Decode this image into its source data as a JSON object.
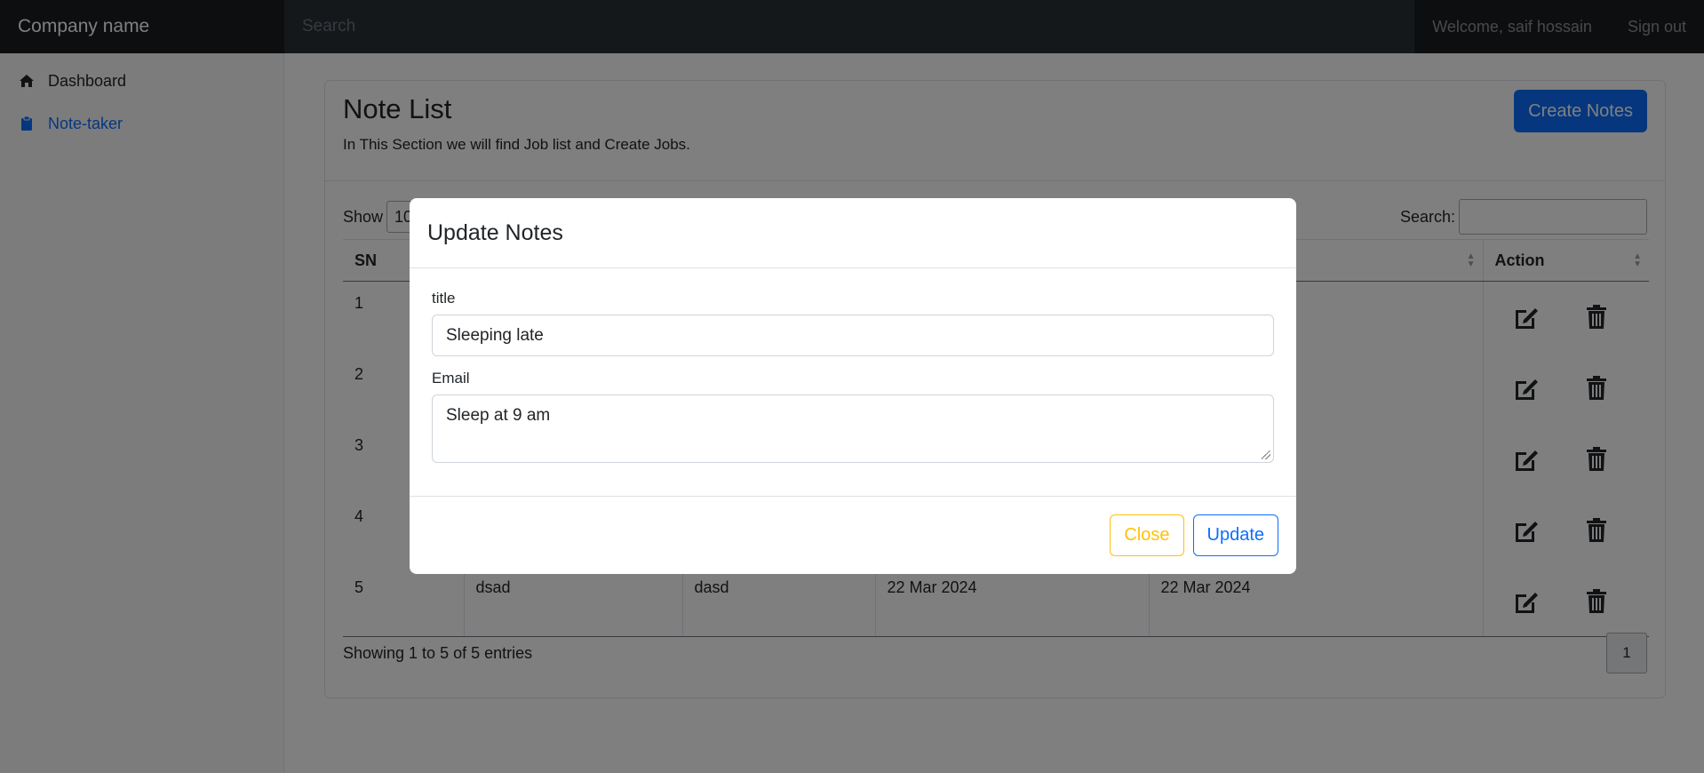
{
  "navbar": {
    "brand": "Company name",
    "search_placeholder": "Search",
    "welcome": "Welcome, saif hossain",
    "signout": "Sign out"
  },
  "sidebar": {
    "items": [
      {
        "label": "Dashboard",
        "icon": "home-icon",
        "active": false
      },
      {
        "label": "Note-taker",
        "icon": "clipboard-icon",
        "active": true
      }
    ]
  },
  "card": {
    "title": "Note List",
    "subtitle": "In This Section we will find Job list and Create Jobs.",
    "create_button": "Create Notes"
  },
  "datatable": {
    "show_label": "Show",
    "show_value": "10",
    "search_label": "Search:",
    "columns": [
      "SN",
      "",
      "",
      "",
      "",
      "Action"
    ],
    "rows": [
      {
        "sn": "1",
        "c1": "",
        "c2": "",
        "c3": "",
        "c4": ""
      },
      {
        "sn": "2",
        "c1": "",
        "c2": "",
        "c3": "",
        "c4": ""
      },
      {
        "sn": "3",
        "c1": "",
        "c2": "",
        "c3": "",
        "c4": ""
      },
      {
        "sn": "4",
        "c1": "",
        "c2": "",
        "c3": "",
        "c4": ""
      },
      {
        "sn": "5",
        "c1": "dsad",
        "c2": "dasd",
        "c3": "22 Mar 2024",
        "c4": "22 Mar 2024"
      }
    ],
    "info": "Showing 1 to 5 of 5 entries",
    "page": "1"
  },
  "modal": {
    "title": "Update Notes",
    "field1_label": "title",
    "field1_value": "Sleeping late",
    "field2_label": "Email",
    "field2_value": "Sleep at 9 am",
    "close_button": "Close",
    "update_button": "Update"
  },
  "colors": {
    "primary": "#0d6efd",
    "warning": "#ffc107",
    "navbar": "#212529"
  }
}
